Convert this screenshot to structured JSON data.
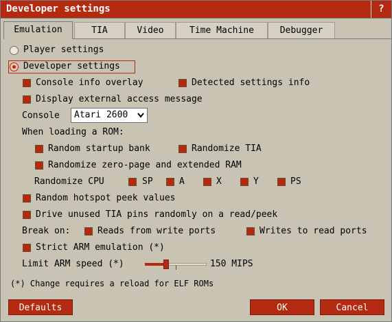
{
  "window": {
    "title": "Developer settings",
    "help_label": "?"
  },
  "tabs": [
    "Emulation",
    "TIA",
    "Video",
    "Time Machine",
    "Debugger"
  ],
  "mode": {
    "player_label": "Player settings",
    "developer_label": "Developer settings",
    "selected": "developer"
  },
  "options": {
    "console_info_overlay": "Console info overlay",
    "detected_settings_info": "Detected settings info",
    "display_external_access": "Display external access message",
    "console_label": "Console",
    "console_value": "Atari 2600",
    "when_loading": "When loading a ROM:",
    "random_startup_bank": "Random startup bank",
    "randomize_tia": "Randomize TIA",
    "randomize_zero_page": "Randomize zero-page and extended RAM",
    "randomize_cpu_label": "Randomize CPU",
    "cpu_regs": [
      "SP",
      "A",
      "X",
      "Y",
      "PS"
    ],
    "random_hotspot": "Random hotspot peek values",
    "drive_unused_tia": "Drive unused TIA pins randomly on a read/peek",
    "break_on_label": "Break on:",
    "reads_from_write": "Reads from write ports",
    "writes_to_read": "Writes to read ports",
    "strict_arm": "Strict ARM emulation (*)",
    "limit_arm_label": "Limit ARM speed (*)",
    "limit_arm_value": "150 MIPS",
    "limit_arm_level": 0.35,
    "footnote": "(*) Change requires a reload for ELF ROMs"
  },
  "buttons": {
    "defaults": "Defaults",
    "ok": "OK",
    "cancel": "Cancel"
  },
  "colors": {
    "accent": "#b42a10",
    "background": "#c9c3b3",
    "text": "#000000"
  }
}
